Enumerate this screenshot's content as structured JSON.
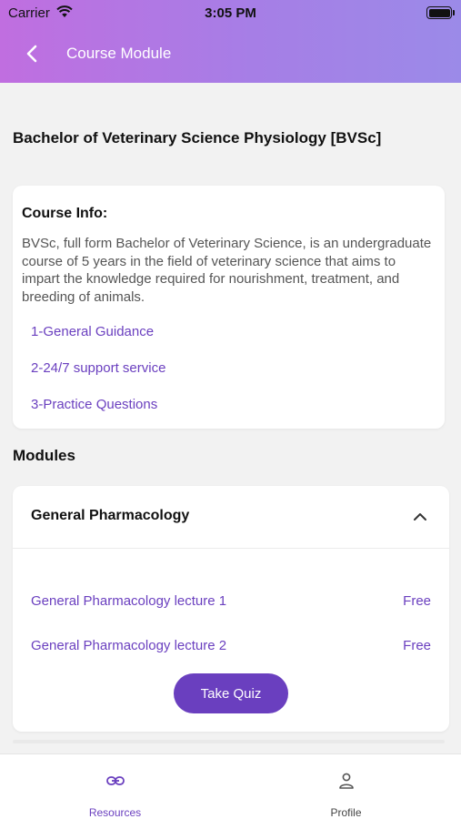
{
  "status_bar": {
    "carrier": "Carrier",
    "time": "3:05 PM"
  },
  "nav": {
    "title": "Course Module",
    "back_icon": "chevron-left-icon"
  },
  "course": {
    "title": "Bachelor of Veterinary Science Physiology [BVSc]",
    "info_heading": "Course Info:",
    "info_description": "BVSc, full form Bachelor of Veterinary Science, is an undergraduate course of 5 years in the field of veterinary science that aims to impart the knowledge required for nourishment, treatment, and breeding of animals.",
    "links": [
      "1-General Guidance",
      "2-24/7 support service",
      "3-Practice Questions"
    ]
  },
  "modules": {
    "heading": "Modules",
    "items": [
      {
        "title": "General Pharmacology",
        "expanded": true,
        "lectures": [
          {
            "name": "General Pharmacology lecture 1",
            "price": "Free"
          },
          {
            "name": "General Pharmacology lecture 2",
            "price": "Free"
          }
        ],
        "quiz_label": "Take Quiz"
      }
    ]
  },
  "tabbar": {
    "tabs": [
      {
        "label": "Resources",
        "icon": "link-icon",
        "active": true
      },
      {
        "label": "Profile",
        "icon": "person-icon",
        "active": false
      }
    ]
  },
  "colors": {
    "accent": "#6a3fbf",
    "header_start": "#c06ee0",
    "header_end": "#9b8ae8"
  }
}
